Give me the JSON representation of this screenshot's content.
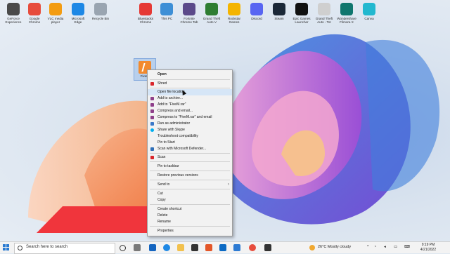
{
  "desktop": {
    "icons": [
      {
        "label": "GeForce Experience",
        "color": "#4a4a4a"
      },
      {
        "label": "Google Chrome",
        "color": "#e74c3c"
      },
      {
        "label": "VLC media player",
        "color": "#f39c12"
      },
      {
        "label": "Microsoft Edge",
        "color": "#1e88e5"
      },
      {
        "label": "Recycle Bin",
        "color": "#9aa5b1"
      },
      {
        "label": "Bluestacks Chrome",
        "color": "#e53935"
      },
      {
        "label": "This PC",
        "color": "#3d8fd6"
      },
      {
        "label": "Fortnite Chrome Tab",
        "color": "#5b4a8a"
      },
      {
        "label": "Grand Theft Auto V",
        "color": "#2e7d32"
      },
      {
        "label": "Rockstar Games",
        "color": "#f4b400"
      },
      {
        "label": "Discord",
        "color": "#5865f2"
      },
      {
        "label": "Steam",
        "color": "#1b2838"
      },
      {
        "label": "Epic Games Launcher",
        "color": "#111111"
      },
      {
        "label": "Grand Theft Auto - Tor",
        "color": "#cfcfcf"
      },
      {
        "label": "Wondershare Filmora X",
        "color": "#0f766e"
      },
      {
        "label": "Canva",
        "color": "#22b8cf"
      }
    ],
    "selected_icon_label": "FiveM"
  },
  "context_menu": {
    "items": [
      {
        "label": "Open",
        "icon": "none",
        "bold": true
      },
      {
        "label": "Shred",
        "icon": "shred-icon"
      },
      {
        "label": "Open file location",
        "icon": "none",
        "highlight": true
      },
      {
        "label": "Add to archive...",
        "icon": "winrar-icon"
      },
      {
        "label": "Add to \"FiveM.rar\"",
        "icon": "winrar-icon"
      },
      {
        "label": "Compress and email...",
        "icon": "winrar-icon"
      },
      {
        "label": "Compress to \"FiveM.rar\" and email",
        "icon": "winrar-icon"
      },
      {
        "label": "Run as administrator",
        "icon": "shield-icon"
      },
      {
        "label": "Share with Skype",
        "icon": "skype-icon"
      },
      {
        "label": "Troubleshoot compatibility",
        "icon": "none"
      },
      {
        "label": "Pin to Start",
        "icon": "none"
      },
      {
        "label": "Scan with Microsoft Defender...",
        "icon": "defender-icon"
      },
      {
        "label": "Scan",
        "icon": "scan-icon"
      },
      {
        "label": "Pin to taskbar",
        "icon": "none"
      },
      {
        "label": "Restore previous versions",
        "icon": "none"
      },
      {
        "label": "Send to",
        "icon": "none",
        "submenu": true
      },
      {
        "label": "Cut",
        "icon": "none"
      },
      {
        "label": "Copy",
        "icon": "none"
      },
      {
        "label": "Create shortcut",
        "icon": "none"
      },
      {
        "label": "Delete",
        "icon": "none"
      },
      {
        "label": "Rename",
        "icon": "none"
      },
      {
        "label": "Properties",
        "icon": "none"
      }
    ]
  },
  "taskbar": {
    "search_placeholder": "Search here to search",
    "weather": "26°C  Mostly cloudy",
    "time": "9:19 PM",
    "date": "4/21/2022",
    "colors": {
      "windows_blue": "#2b7bd1",
      "banner_red": "#f0353c"
    }
  }
}
